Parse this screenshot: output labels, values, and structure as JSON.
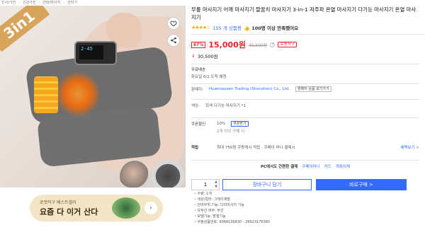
{
  "breadcrumb": [
    "인사/가전",
    "건강가전",
    "안마/마사지",
    "안마기"
  ],
  "image": {
    "badge_text": "3in1",
    "device_screen": "2‑45"
  },
  "banner": {
    "subtitle": "로켓직구 베스트셀러",
    "title": "요즘 다 이거 산다"
  },
  "product": {
    "title": "무릎 마사지기 어깨 마사지기 팔꿈치 마사지기 3-in-1 저주파 온열 마사지기 다기능 마사지기 온열 마사지기",
    "stars": "★★★★☆",
    "review_count": "155 개 상품평",
    "purchases": "👍 100명 이상 만족했어요",
    "discount": "67%",
    "price": "15,000원",
    "original_price": "45,500원",
    "rocket_label": "로켓직구",
    "second_price_arrow": "↓",
    "second_price": "30,500원"
  },
  "shipping": {
    "label": "무료배송",
    "date": "화요일 6/2 도착 예정"
  },
  "seller": {
    "label": "판매자:",
    "name": "Huamiaosen Trading (Shenzhen) Co., Ltd.",
    "button": "판매자 상품 보기가기"
  },
  "option": {
    "label": "색상:",
    "value": "회색 다기능 마사지기 *1"
  },
  "coupon": {
    "label": "쿠폰할인",
    "rate": "10%",
    "button": "쿠폰받기",
    "note": "2개 이상 구매 시"
  },
  "points": {
    "label": "적립",
    "text": "최대 750원 쿠팡캐시 적립 · 쿠페이 머니 결제시",
    "link": "혜택보기 >"
  },
  "pc_payment": {
    "text": "PC에서도 간편한 결제",
    "opt1": "쿠페이머니",
    "opt2": "카드",
    "opt3": "계좌이체"
  },
  "purchase": {
    "quantity": "1",
    "cart_button": "장바구니 담기",
    "buy_button": "바로구매 >"
  },
  "specs": [
    "수량: 1개",
    "색상/컬러: 그레이계열",
    "안마부위 기능: 다리마사지 기능",
    "유무선 여부: 무선",
    "모델기능: 발열기능",
    "쿠팡상품번호: 9066109830 - 26623176365"
  ],
  "colors": {
    "accent": "#346aff",
    "price": "#e52528",
    "banner_bg": "#f3e6c7"
  }
}
